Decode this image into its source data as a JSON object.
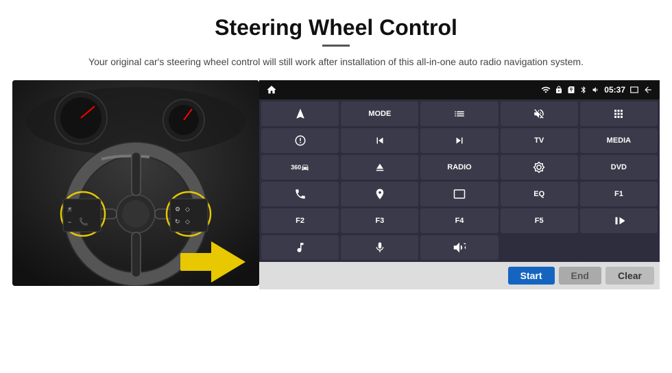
{
  "header": {
    "title": "Steering Wheel Control",
    "subtitle": "Your original car's steering wheel control will still work after installation of this all-in-one auto radio navigation system."
  },
  "status_bar": {
    "time": "05:37",
    "icons": [
      "wifi",
      "lock",
      "sim",
      "bluetooth",
      "volume",
      "window",
      "back"
    ]
  },
  "button_rows": [
    [
      {
        "type": "icon",
        "icon": "navigate",
        "label": ""
      },
      {
        "type": "text",
        "label": "MODE"
      },
      {
        "type": "icon",
        "icon": "list",
        "label": ""
      },
      {
        "type": "icon",
        "icon": "mute",
        "label": ""
      },
      {
        "type": "icon",
        "icon": "apps",
        "label": ""
      }
    ],
    [
      {
        "type": "icon",
        "icon": "settings-circle",
        "label": ""
      },
      {
        "type": "icon",
        "icon": "prev",
        "label": ""
      },
      {
        "type": "icon",
        "icon": "next",
        "label": ""
      },
      {
        "type": "text",
        "label": "TV"
      },
      {
        "type": "text",
        "label": "MEDIA"
      }
    ],
    [
      {
        "type": "icon",
        "icon": "360-car",
        "label": ""
      },
      {
        "type": "icon",
        "icon": "eject",
        "label": ""
      },
      {
        "type": "text",
        "label": "RADIO"
      },
      {
        "type": "icon",
        "icon": "brightness",
        "label": ""
      },
      {
        "type": "text",
        "label": "DVD"
      }
    ],
    [
      {
        "type": "icon",
        "icon": "phone",
        "label": ""
      },
      {
        "type": "icon",
        "icon": "compass",
        "label": ""
      },
      {
        "type": "icon",
        "icon": "window-rect",
        "label": ""
      },
      {
        "type": "text",
        "label": "EQ"
      },
      {
        "type": "text",
        "label": "F1"
      }
    ],
    [
      {
        "type": "text",
        "label": "F2"
      },
      {
        "type": "text",
        "label": "F3"
      },
      {
        "type": "text",
        "label": "F4"
      },
      {
        "type": "text",
        "label": "F5"
      },
      {
        "type": "icon",
        "icon": "play-pause",
        "label": ""
      }
    ],
    [
      {
        "type": "icon",
        "icon": "music",
        "label": ""
      },
      {
        "type": "icon",
        "icon": "mic",
        "label": ""
      },
      {
        "type": "icon",
        "icon": "vol-phone",
        "label": ""
      },
      {
        "type": "empty",
        "label": ""
      },
      {
        "type": "empty",
        "label": ""
      }
    ]
  ],
  "action_bar": {
    "start_label": "Start",
    "end_label": "End",
    "clear_label": "Clear"
  }
}
